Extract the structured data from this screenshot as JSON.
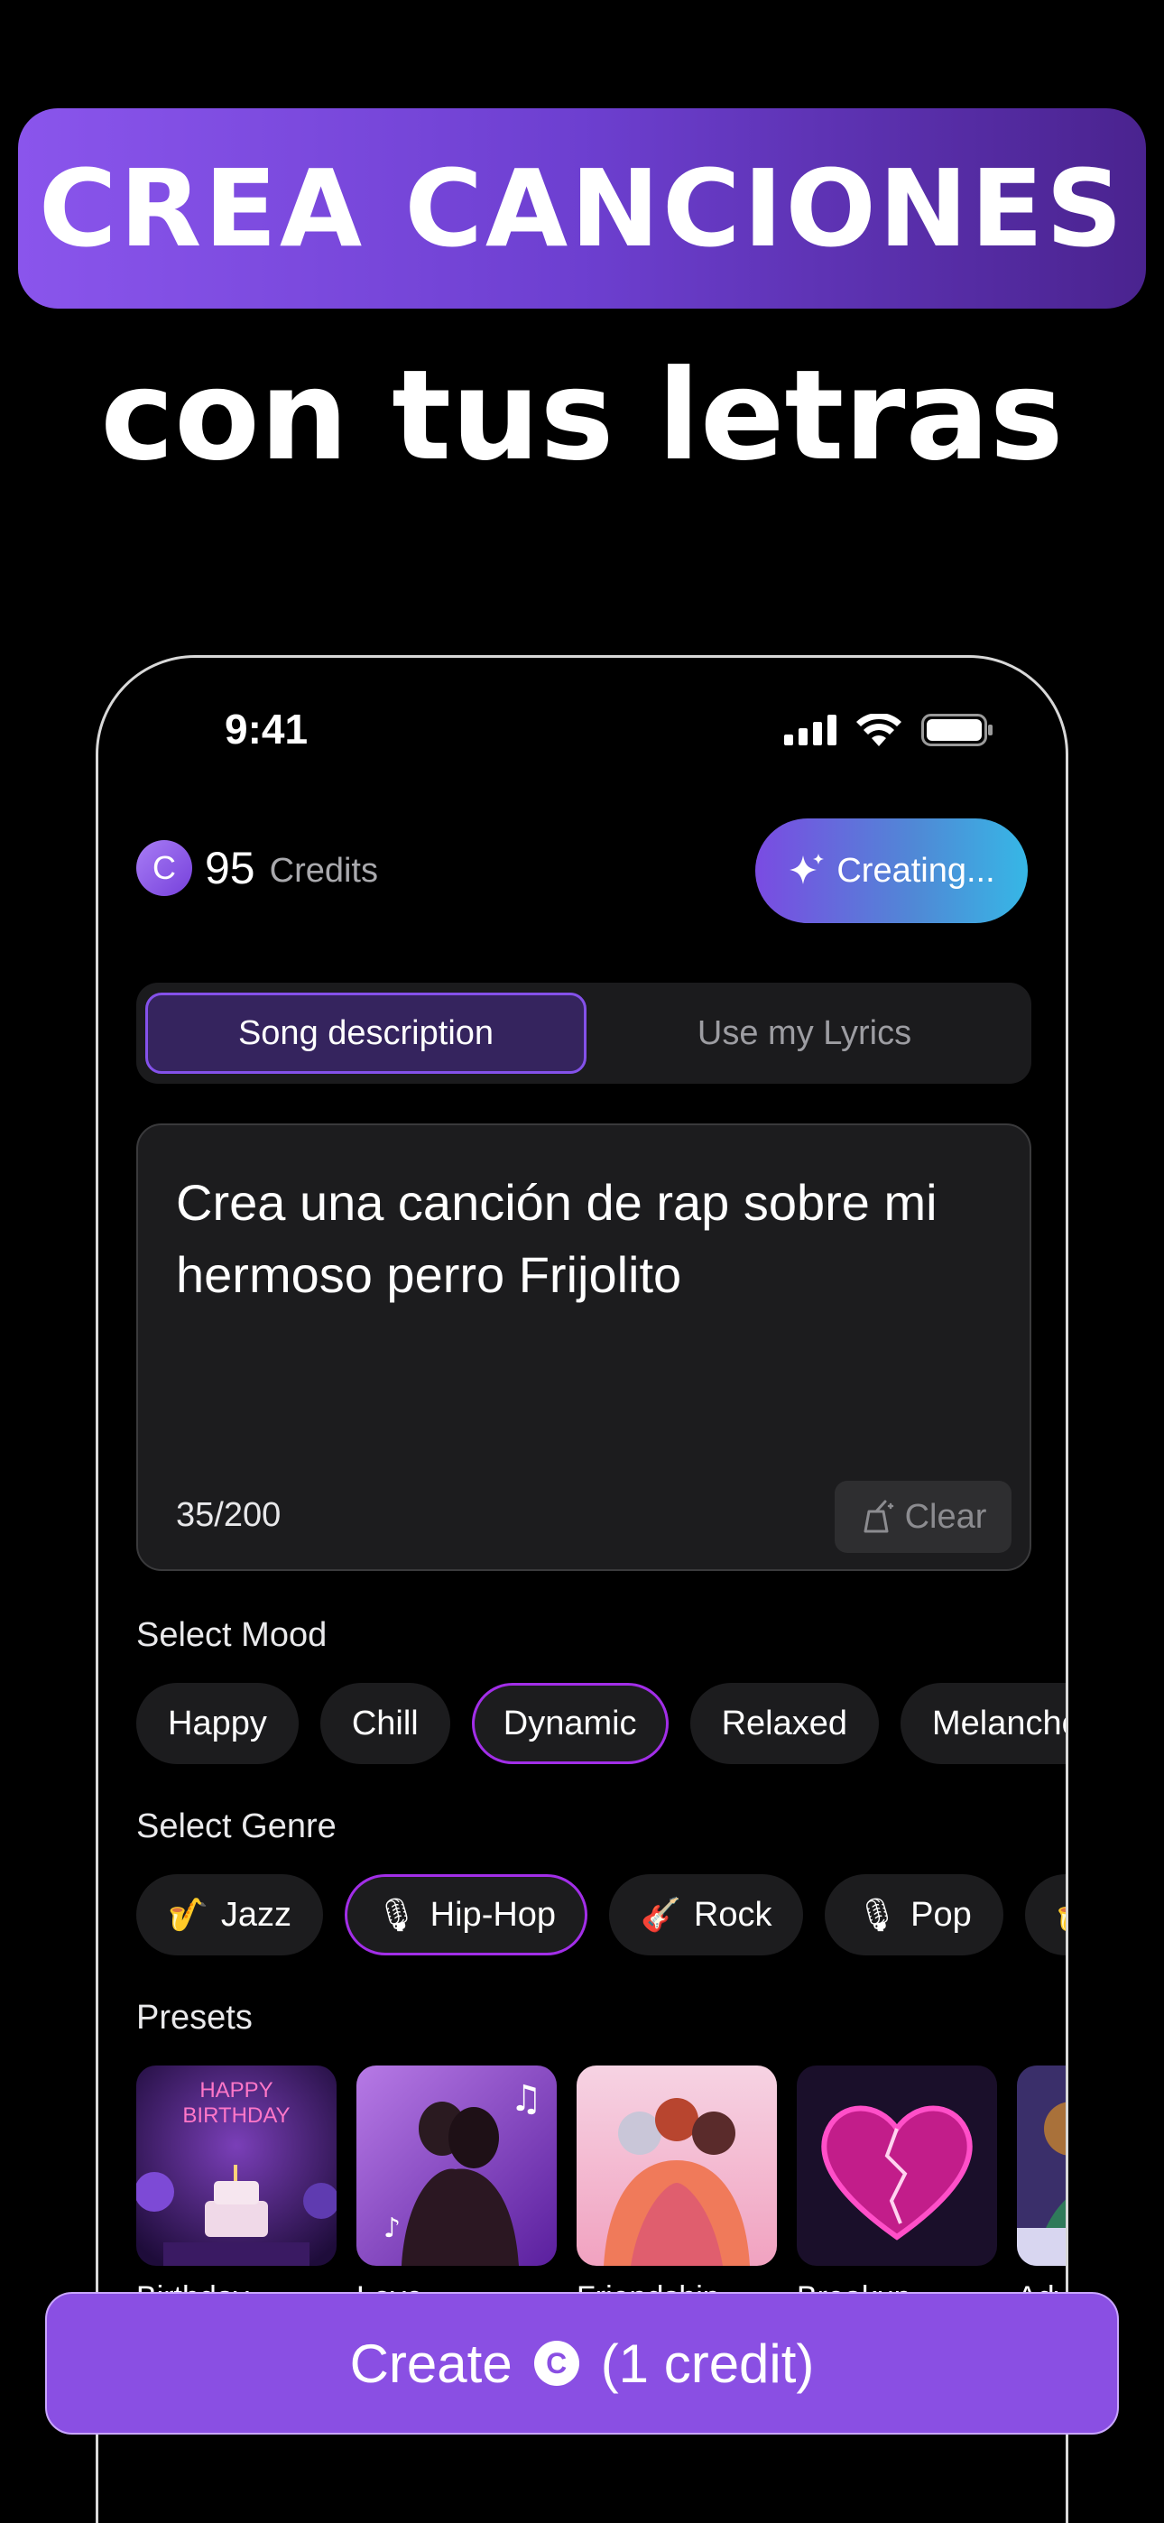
{
  "hero": {
    "title": "CREA CANCIONES",
    "subtitle": "con tus letras"
  },
  "status_bar": {
    "time": "9:41"
  },
  "header": {
    "coin_letter": "C",
    "credits_value": "95",
    "credits_label": "Credits",
    "creating_label": "Creating..."
  },
  "tabs": [
    {
      "label": "Song description",
      "active": true
    },
    {
      "label": "Use my Lyrics",
      "active": false
    }
  ],
  "prompt": {
    "text": "Crea una canción de rap sobre mi hermoso perro Frijolito",
    "counter": "35/200",
    "clear_label": "Clear"
  },
  "mood": {
    "label": "Select Mood",
    "options": [
      {
        "label": "Happy",
        "active": false
      },
      {
        "label": "Chill",
        "active": false
      },
      {
        "label": "Dynamic",
        "active": true
      },
      {
        "label": "Relaxed",
        "active": false
      },
      {
        "label": "Melancholic",
        "active": false
      }
    ]
  },
  "genre": {
    "label": "Select Genre",
    "options": [
      {
        "label": "Jazz",
        "icon": "saxophone-icon",
        "active": false
      },
      {
        "label": "Hip-Hop",
        "icon": "microphone-icon",
        "active": true
      },
      {
        "label": "Rock",
        "icon": "guitar-icon",
        "active": false
      },
      {
        "label": "Pop",
        "icon": "microphone-icon",
        "active": false
      },
      {
        "label": "",
        "icon": "saxophone-icon",
        "active": false
      }
    ]
  },
  "presets": {
    "label": "Presets",
    "items": [
      {
        "label": "Birthday",
        "image_text": "HAPPY BIRTHDAY"
      },
      {
        "label": "Love"
      },
      {
        "label": "Friendship"
      },
      {
        "label": "Breakup"
      },
      {
        "label": "Adventure"
      }
    ]
  },
  "create": {
    "label": "Create",
    "coin_letter": "C",
    "cost": "(1 credit)"
  },
  "colors": {
    "accent": "#8a4fe3",
    "active_border": "#a22ee8",
    "background": "#000000"
  }
}
